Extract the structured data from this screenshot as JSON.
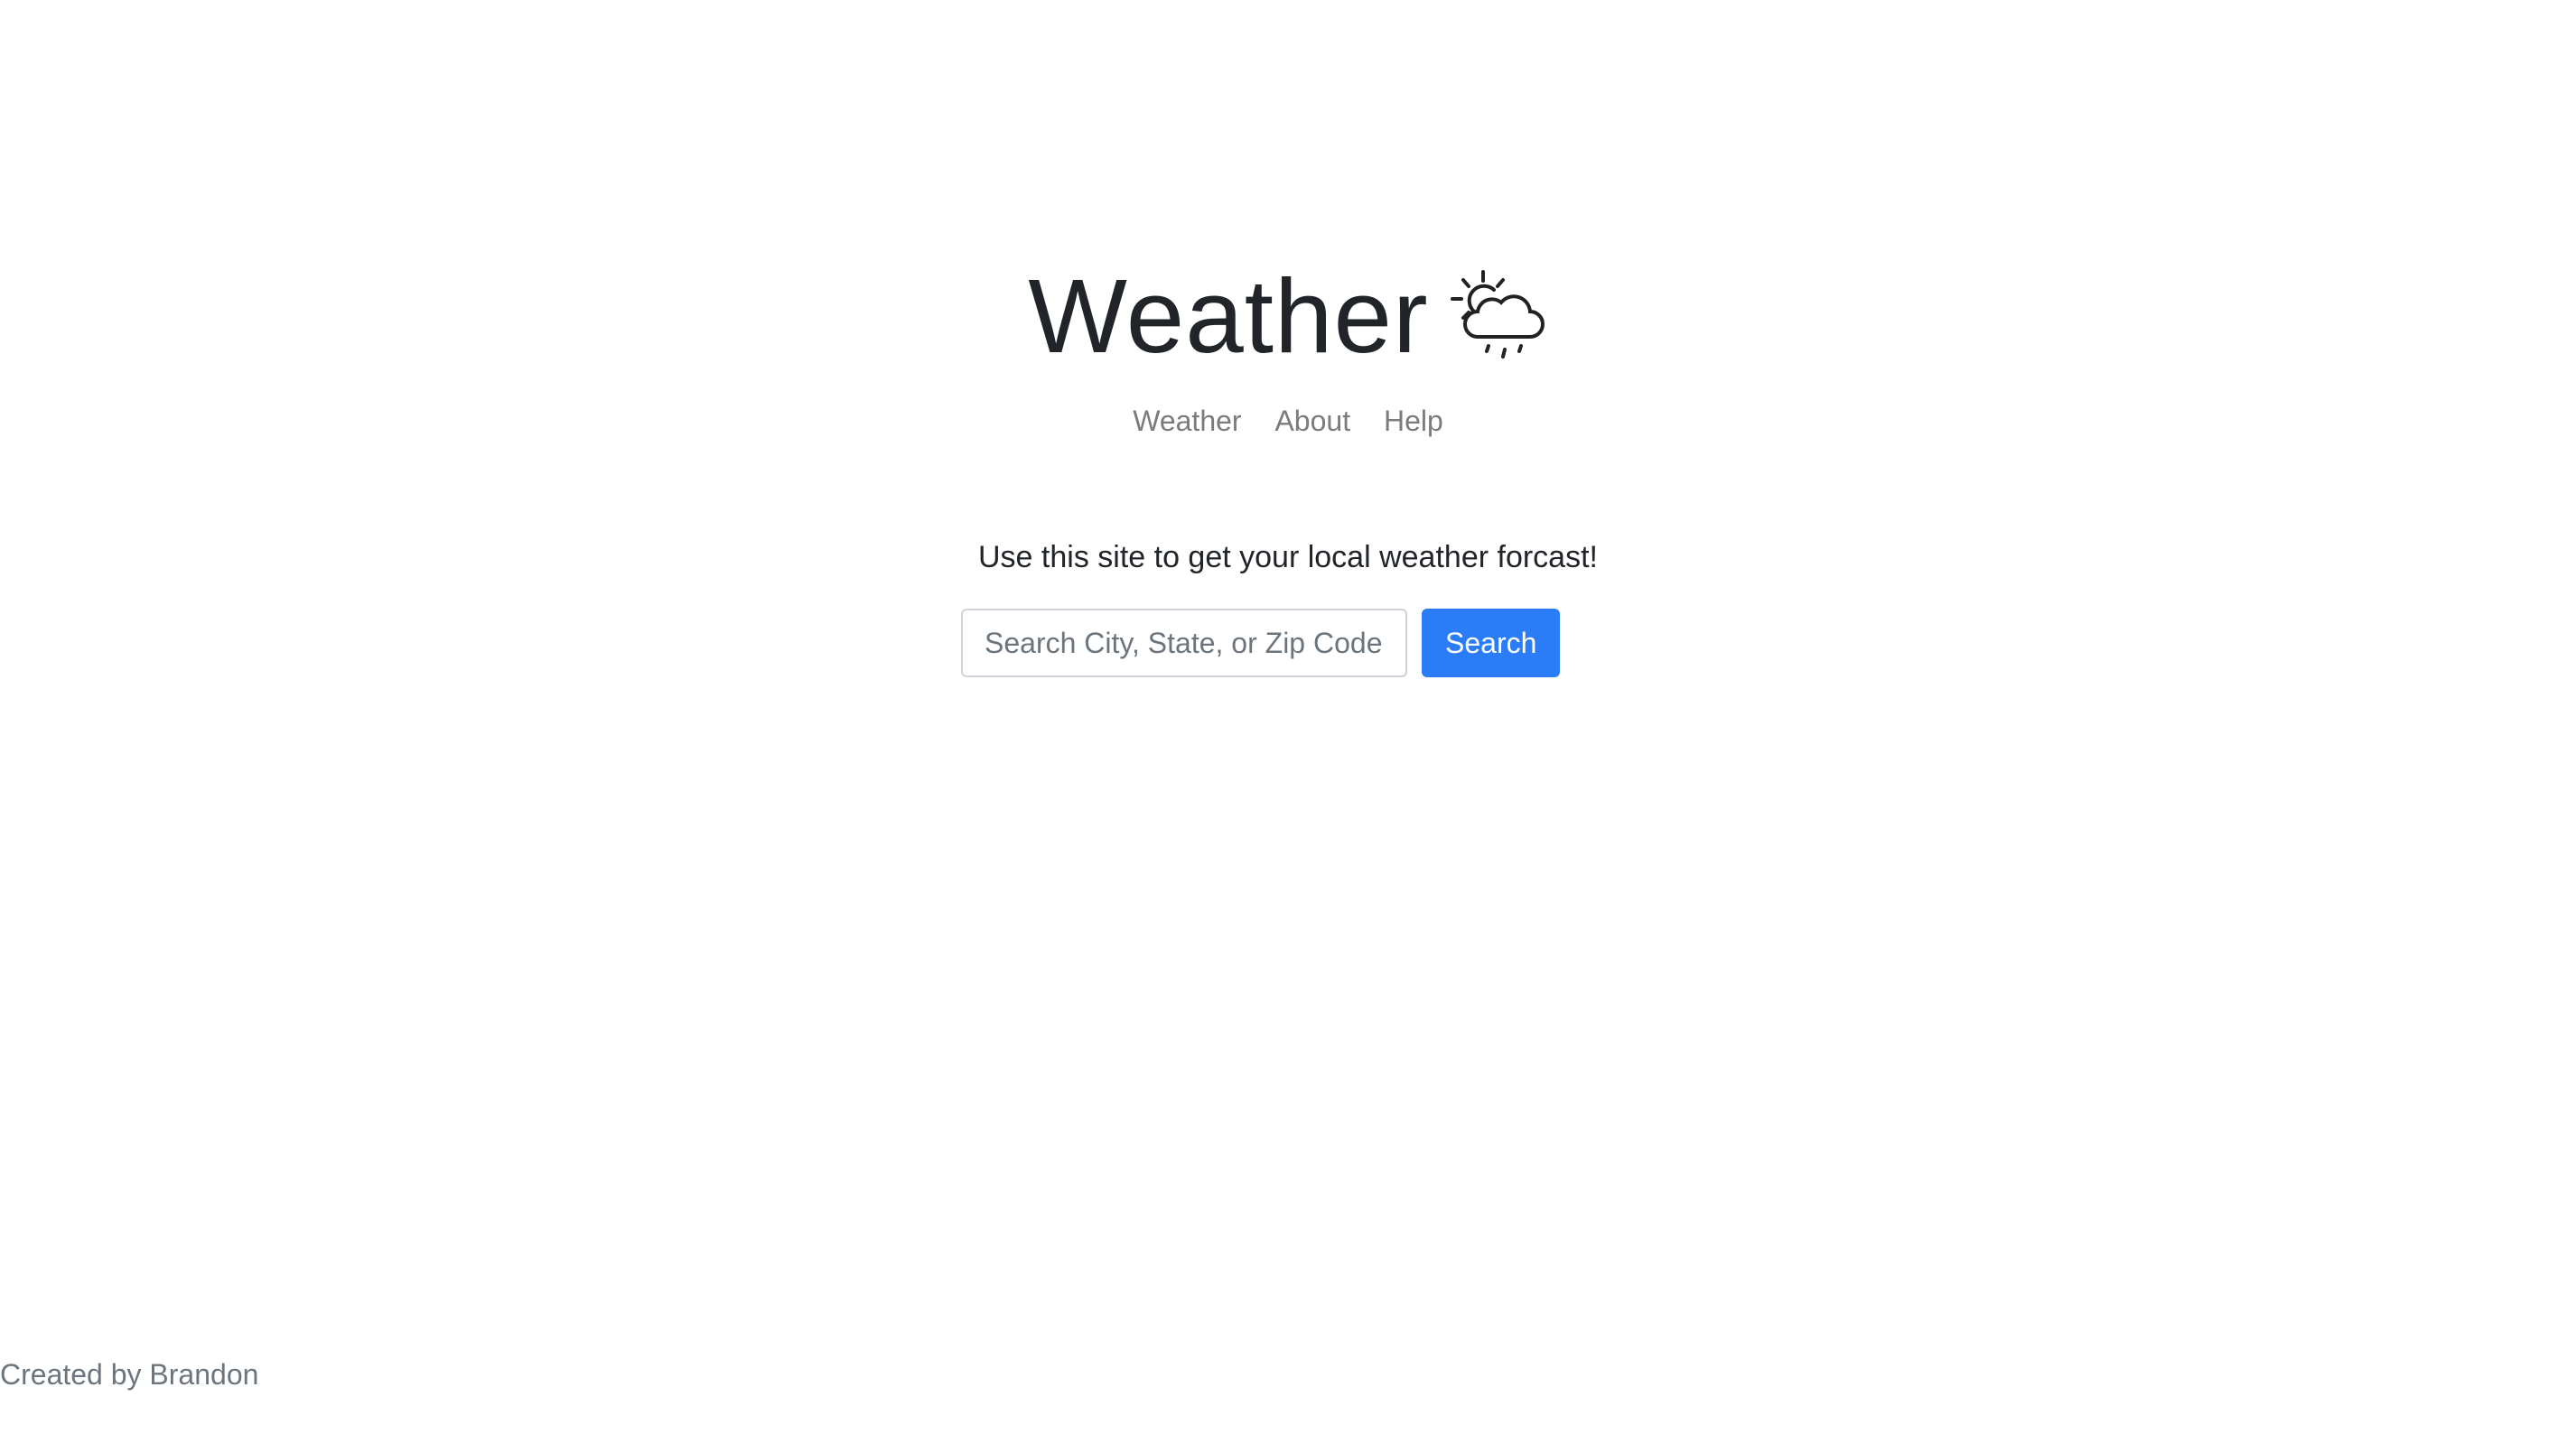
{
  "header": {
    "title": "Weather",
    "logo_icon": "sun-cloud-rain-icon"
  },
  "nav": {
    "items": [
      {
        "label": "Weather"
      },
      {
        "label": "About"
      },
      {
        "label": "Help"
      }
    ]
  },
  "main": {
    "intro": "Use this site to get your local weather forcast!",
    "search": {
      "value": "",
      "placeholder": "Search City, State, or Zip Code",
      "button_label": "Search"
    }
  },
  "footer": {
    "text": "Created by Brandon"
  },
  "colors": {
    "accent": "#2b7df7",
    "nav_link": "#7b7b7b",
    "text": "#212529"
  }
}
